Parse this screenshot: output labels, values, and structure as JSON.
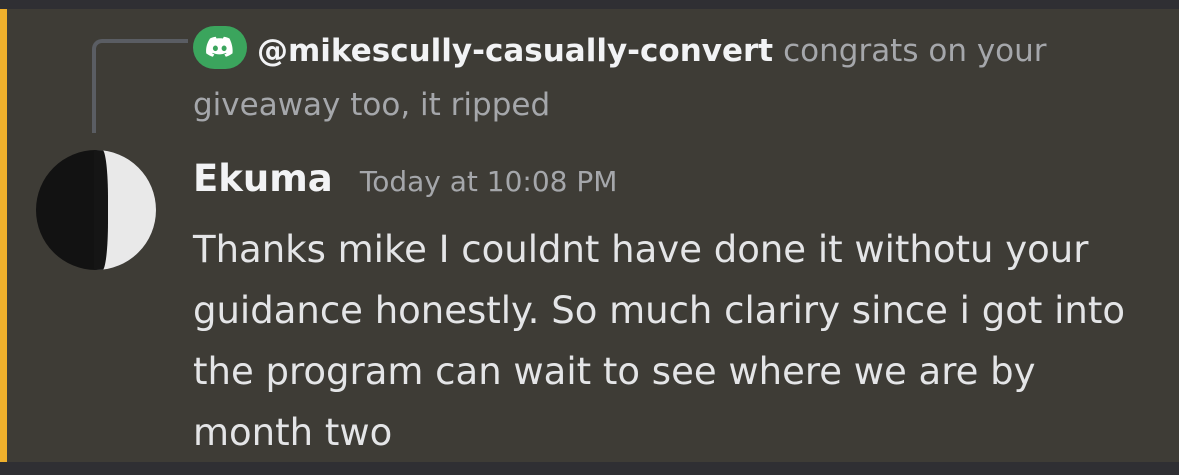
{
  "reply": {
    "author": "@mikescully-casually-convert",
    "text": "congrats on your giveaway too, it ripped",
    "avatar_icon": "discord-logo-icon",
    "avatar_color": "#3ba55d"
  },
  "message": {
    "author": "Ekuma",
    "timestamp": "Today at 10:08 PM",
    "text": "Thanks mike I couldnt have done it withotu your guidance honestly. So much clariry since i got into the program can wait to see where we are by month two"
  },
  "colors": {
    "highlight": "#efb02c",
    "message_bg": "#3e3c36",
    "page_bg": "#2f2f33"
  }
}
